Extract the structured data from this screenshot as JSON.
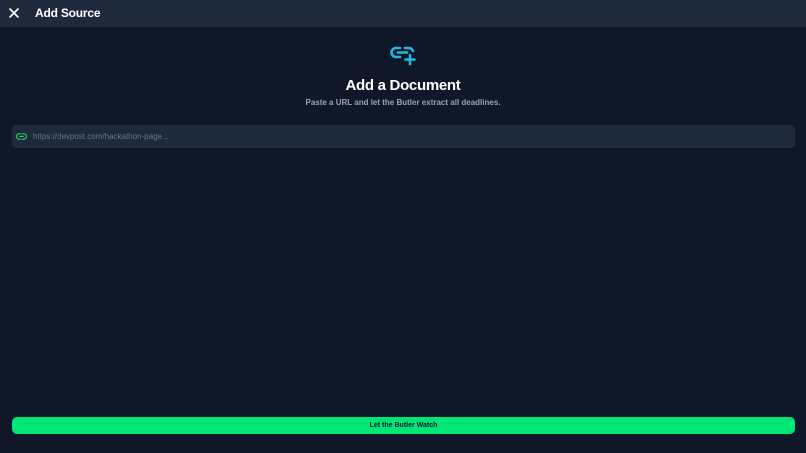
{
  "header": {
    "title": "Add Source",
    "close_icon": "close-icon"
  },
  "main": {
    "hero_icon": "link-add-icon",
    "heading": "Add a Document",
    "subtext": "Paste a URL and let the Butler extract all deadlines.",
    "url_field": {
      "icon": "link-icon",
      "value": "",
      "placeholder": "https://devpost.com/hackathon-page..."
    }
  },
  "footer": {
    "watch_label": "Let the Butler Watch"
  },
  "colors": {
    "background": "#0f1729",
    "panel": "#1e293b",
    "accent_cyan": "#22b8e0",
    "accent_green": "#00e676"
  }
}
